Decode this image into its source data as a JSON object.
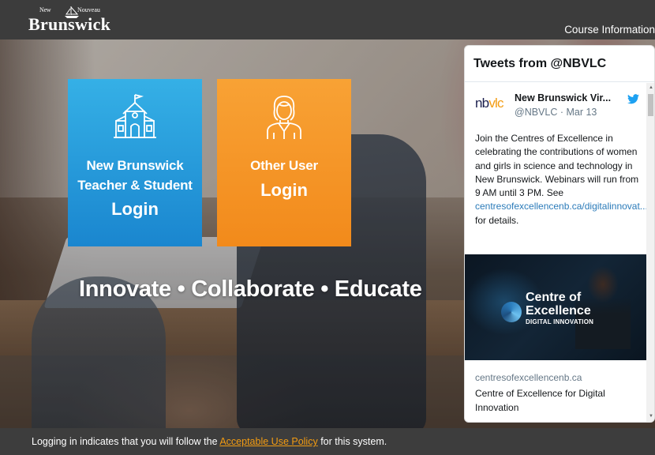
{
  "header": {
    "logo_small_left": "New",
    "logo_small_right": "Nouveau",
    "logo_main": "Brunswick",
    "course_info_link": "Course Information"
  },
  "tiles": {
    "teacher": {
      "line1": "New Brunswick",
      "line2": "Teacher & Student",
      "line3": "Login",
      "icon": "school-building-icon",
      "color": "#1f98db"
    },
    "other": {
      "line1": "Other User",
      "line3": "Login",
      "icon": "user-person-icon",
      "color": "#f7941d"
    }
  },
  "tagline": "Innovate • Collaborate • Educate",
  "twitter": {
    "title": "Tweets from @NBVLC",
    "avatar_text_a": "nb",
    "avatar_text_b": "vlc",
    "name": "New Brunswick Vir...",
    "handle": "@NBVLC · Mar 13",
    "tweet_text": "Join the Centres of Excellence in celebrating the contributions of women and girls in science and technology in New Brunswick. Webinars will run from 9 AM until 3 PM. See ",
    "tweet_link": "centresofexcellencenb.ca/digitalinnovat...",
    "tweet_suffix": " for details.",
    "image_line1": "Centre of",
    "image_line2": "Excellence",
    "image_line3": "DIGITAL INNOVATION",
    "card_domain": "centresofexcellencenb.ca",
    "card_title": "Centre of Excellence for Digital Innovation",
    "accent": "#1da1f2"
  },
  "footer": {
    "prefix": "Logging in indicates that you will follow the ",
    "link": "Acceptable Use Policy",
    "suffix": " for this system."
  }
}
